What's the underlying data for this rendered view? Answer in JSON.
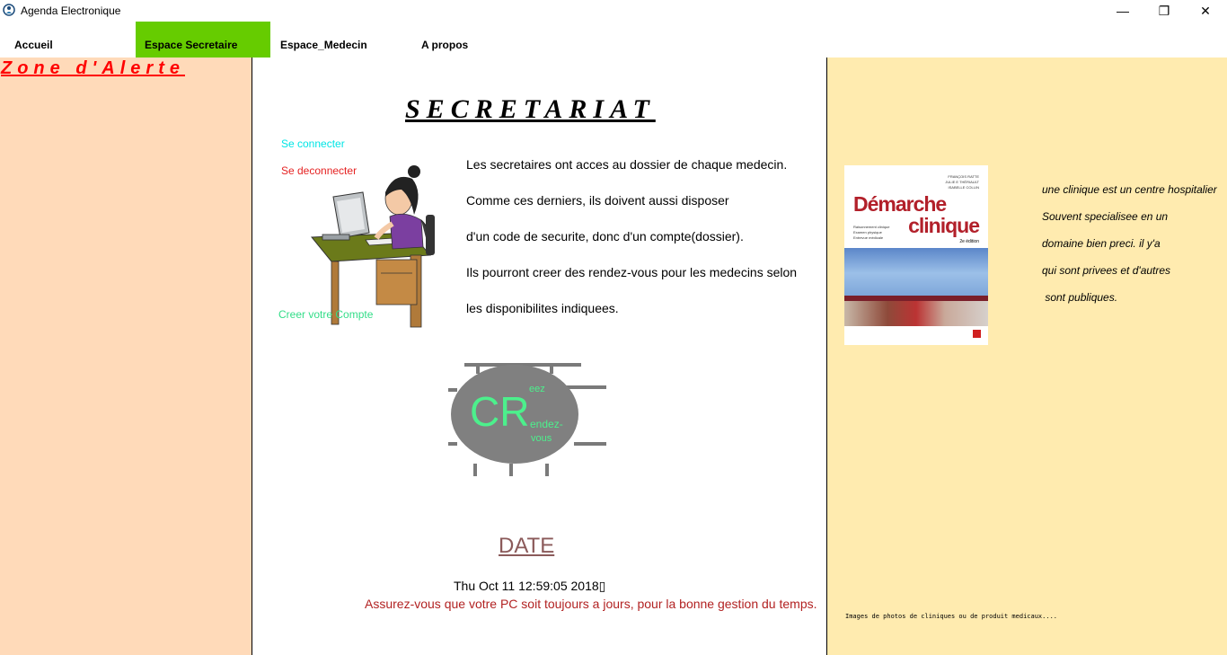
{
  "window": {
    "title": "Agenda Electronique",
    "controls": {
      "minimize": "—",
      "maximize": "❐",
      "close": "✕"
    }
  },
  "menu": {
    "items": [
      "Accueil",
      "Espace Secretaire",
      "Espace_Medecin",
      "A propos"
    ],
    "active": "Espace Secretaire",
    "active_color": "#66cc00"
  },
  "left_panel": {
    "title": "Zone d'Alerte",
    "background": "#ffdab9",
    "title_color": "#ff0000"
  },
  "center": {
    "title": "SECRETARIAT",
    "links": {
      "connect": "Se connecter",
      "disconnect": "Se deconnecter",
      "create_account": "Creer votre Compte"
    },
    "description": [
      "Les secretaires ont acces au dossier de chaque medecin.",
      "Comme ces derniers, ils doivent aussi disposer",
      "d'un code de securite, donc d'un compte(dossier).",
      "Ils pourront creer des rendez-vous pour les medecins selon",
      "les disponibilites indiquees."
    ],
    "rdv_button": {
      "big": "CR",
      "top": "eez",
      "middle": "endez-",
      "bottom": "vous"
    },
    "date_title": "DATE",
    "date_value": "Thu Oct 11 12:59:05 2018▯",
    "date_warning": "Assurez-vous que votre PC soit toujours a jours, pour la bonne gestion du temps."
  },
  "right_panel": {
    "background": "#ffebaf",
    "book": {
      "title_line1": "Démarche",
      "title_line2": "clinique",
      "edition": "2e édition",
      "authors": [
        "FRANÇOIS RATTE",
        "JULIE E THÉRIAULT",
        "ISABELLE COLLIN"
      ],
      "subtitle": [
        "Raisonnement clinique",
        "Examen physique",
        "Entrevue médicale"
      ]
    },
    "clinic_text": [
      "une clinique est un centre hospitalier",
      "Souvent specialisee en un",
      "domaine bien preci. il y'a",
      "qui sont privees et d'autres",
      " sont publiques."
    ],
    "caption": "Images de photos de cliniques ou de produit medicaux...."
  }
}
